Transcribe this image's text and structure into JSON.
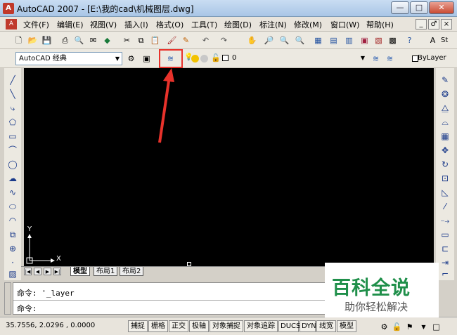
{
  "window": {
    "title": "AutoCAD 2007 - [E:\\我的cad\\机械图层.dwg]",
    "minimize": "—",
    "maximize": "□",
    "close": "✕"
  },
  "menu": {
    "items": [
      "文件(F)",
      "编辑(E)",
      "视图(V)",
      "插入(I)",
      "格式(O)",
      "工具(T)",
      "绘图(D)",
      "标注(N)",
      "修改(M)",
      "窗口(W)",
      "帮助(H)"
    ],
    "mdi": [
      "_",
      "♂",
      "×"
    ]
  },
  "toolbar2": {
    "workspace": "AutoCAD 经典",
    "layer_value": "0",
    "color_control": "ByLayer",
    "style_label": "St"
  },
  "layout": {
    "tabs": [
      "模型",
      "布局1",
      "布局2"
    ]
  },
  "axes": {
    "y": "Y",
    "x": "X"
  },
  "command": {
    "line1": "命令: '_layer",
    "line2": "命令:"
  },
  "status": {
    "coords": "35.7556, 2.0296 , 0.0000",
    "buttons": [
      "捕捉",
      "栅格",
      "正交",
      "极轴",
      "对象捕捉",
      "对象追踪",
      "DUCS",
      "DYN",
      "线宽",
      "模型"
    ]
  },
  "watermark": {
    "title": "百科全说",
    "subtitle": "助你轻松解决"
  },
  "colors": {
    "canvas": "#000000",
    "highlight": "#e8322b",
    "watermark_green": "#1f8f4a"
  }
}
